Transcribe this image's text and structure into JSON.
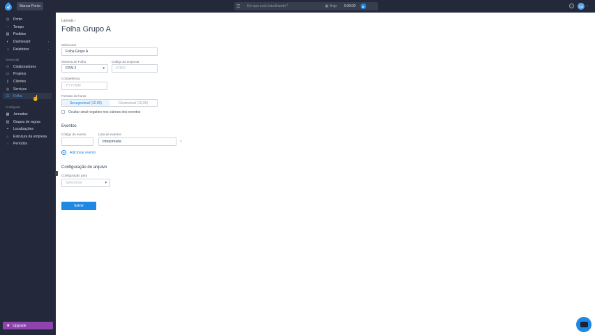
{
  "topbar": {
    "mark_button": "Marcar Ponto",
    "tracker_placeholder": "Em que está trabalhando?",
    "today_label": "Hoje",
    "timer": "0:00:00",
    "avatar_initials": "CM"
  },
  "sidebar": {
    "items": [
      {
        "label": "Ponto",
        "icon": "clock-icon"
      },
      {
        "label": "Tempo",
        "icon": "timer-icon"
      },
      {
        "label": "Pedidos",
        "icon": "document-icon"
      },
      {
        "label": "Dashboard",
        "icon": "dashboard-icon"
      },
      {
        "label": "Relatórios",
        "icon": "report-icon"
      }
    ],
    "manage_section": "Gerenciar",
    "manage_items": [
      {
        "label": "Colaboradores",
        "icon": "users-icon"
      },
      {
        "label": "Projetos",
        "icon": "folder-icon"
      },
      {
        "label": "Clientes",
        "icon": "clipboard-icon"
      },
      {
        "label": "Serviços",
        "icon": "services-icon"
      },
      {
        "label": "Folha",
        "icon": "payroll-icon"
      }
    ],
    "config_section": "Configurar",
    "config_items": [
      {
        "label": "Jornadas",
        "icon": "calendar-icon"
      },
      {
        "label": "Grupos de regras",
        "icon": "rules-icon"
      },
      {
        "label": "Localizações",
        "icon": "location-icon"
      },
      {
        "label": "Estrutura da empresa",
        "icon": "org-icon"
      },
      {
        "label": "Períodos",
        "icon": "period-icon"
      }
    ],
    "upgrade": "Upgrade",
    "active_item": "Folha"
  },
  "main": {
    "breadcrumb": "Layouts",
    "title": "Folha Grupo A",
    "form": {
      "name_label": "Selecionar",
      "name_value": "Folha Grupo A",
      "system_label": "Sistema de Folha",
      "system_value": "FPW 2",
      "company_code_label": "Código da empresa",
      "company_code_placeholder": "#7800",
      "competence_label": "Competência",
      "competence_placeholder": "YYYYMM",
      "hours_format_label": "Formato de horas",
      "hours_options": [
        "Sexagesimal (12:00)",
        "Centesimal (12,00)"
      ],
      "hours_selected": "Sexagesimal (12:00)",
      "hide_negative_label": "Ocultar sinal negativo nos valores dos eventos"
    },
    "events": {
      "title": "Eventos",
      "code_label": "Código do evento",
      "list_label": "Lista de eventos",
      "list_value": "Interjornada",
      "add_label": "Adicionar evento"
    },
    "file_config": {
      "title": "Configuração do arquivo",
      "for_label": "Configuração para",
      "select_placeholder": "Selecionar"
    },
    "save_button": "Salvar"
  },
  "colors": {
    "sidebar_bg": "#23293a",
    "accent": "#1e88e5",
    "upgrade": "#8e44ad"
  }
}
